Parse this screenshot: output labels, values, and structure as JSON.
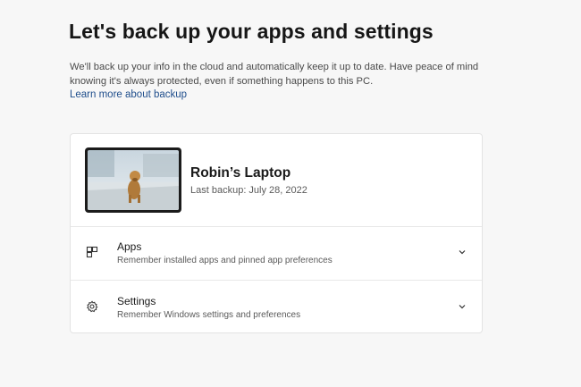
{
  "header": {
    "title": "Let's back up your apps and settings",
    "description": "We'll back up your info in the cloud and automatically keep it up to date. Have peace of mind knowing it's always protected, even if something happens to this PC.",
    "learn_more": "Learn more about backup"
  },
  "device": {
    "name": "Robin’s Laptop",
    "last_backup": "Last backup: July 28, 2022",
    "thumbnail_icon": "dog-wallpaper-laptop"
  },
  "options": [
    {
      "title": "Apps",
      "subtitle": "Remember installed apps and pinned app preferences",
      "icon": "apps-icon"
    },
    {
      "title": "Settings",
      "subtitle": "Remember Windows settings and preferences",
      "icon": "gear-icon"
    }
  ],
  "colors": {
    "link": "#1f4e8c",
    "background": "#f7f7f7",
    "card": "#ffffff"
  }
}
